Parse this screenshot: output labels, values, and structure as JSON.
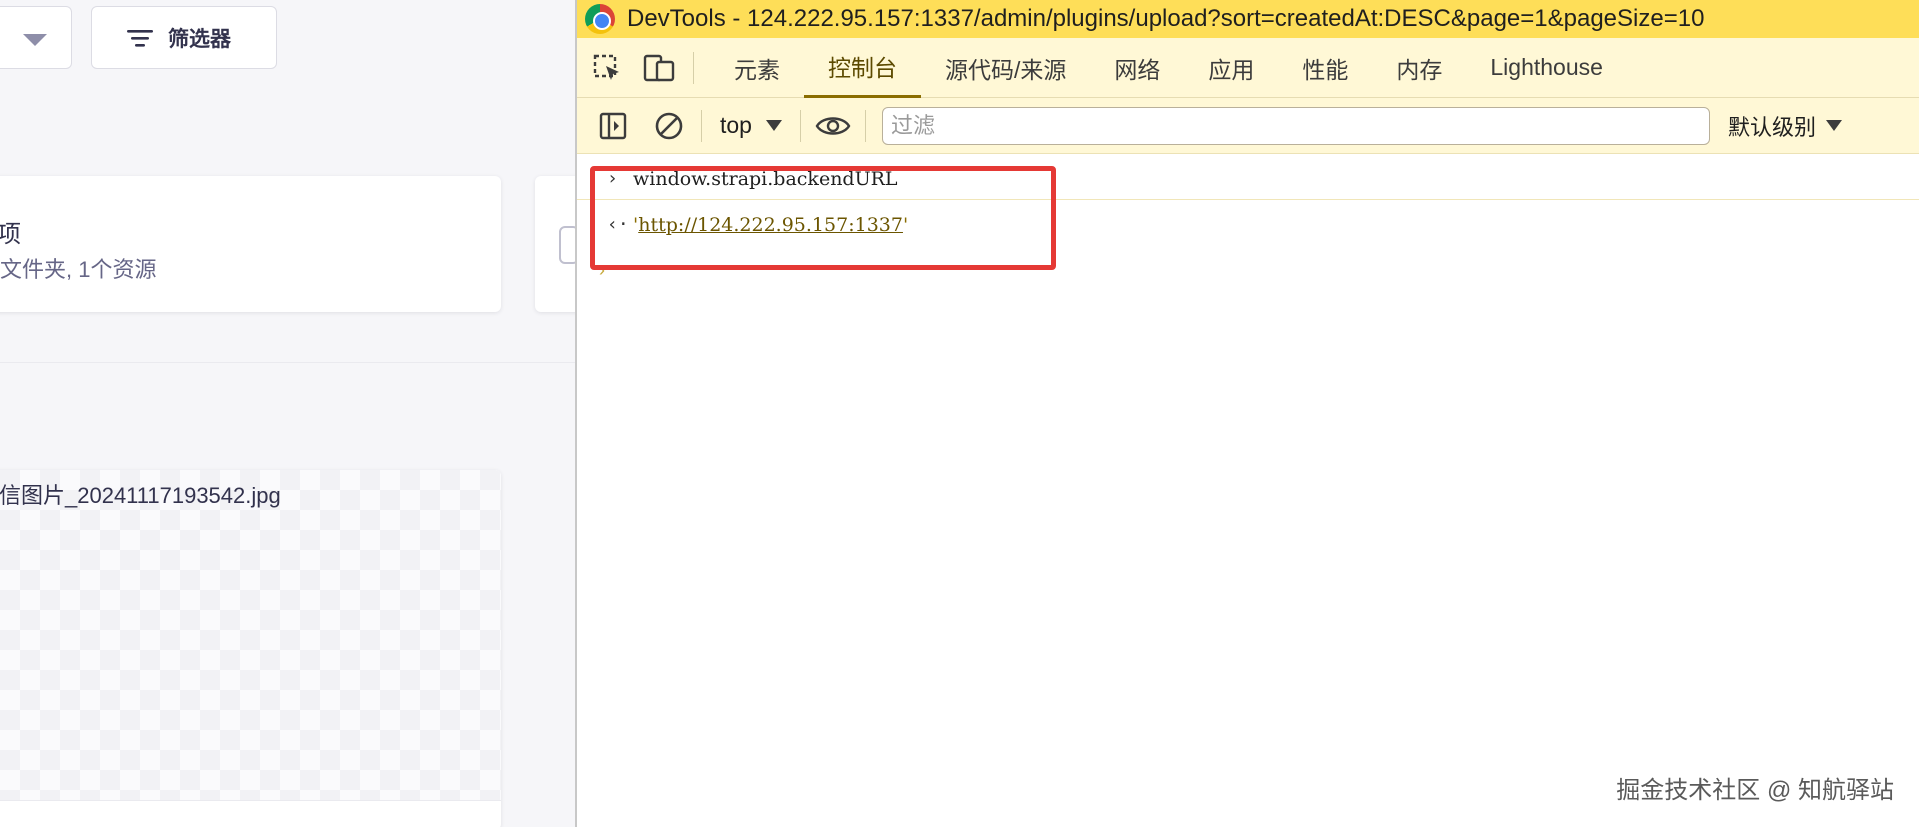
{
  "strapi": {
    "filter_button": "筛选器",
    "folder": {
      "title": "项",
      "subtitle": "文件夹, 1个资源"
    },
    "asset": {
      "name": "信图片_20241117193542.jpg"
    }
  },
  "devtools": {
    "title": "DevTools - 124.222.95.157:1337/admin/plugins/upload?sort=createdAt:DESC&page=1&pageSize=10",
    "tabs": [
      {
        "label": "元素"
      },
      {
        "label": "控制台"
      },
      {
        "label": "源代码/来源"
      },
      {
        "label": "网络"
      },
      {
        "label": "应用"
      },
      {
        "label": "性能"
      },
      {
        "label": "内存"
      },
      {
        "label": "Lighthouse"
      }
    ],
    "active_tab": "控制台",
    "console_toolbar": {
      "context": "top",
      "filter_placeholder": "过滤",
      "filter_value": "",
      "level": "默认级别"
    },
    "console": {
      "input_prompt": "›",
      "input": "window.strapi.backendURL",
      "output_prompt": "‹·",
      "output_quote_open": "'",
      "output_url": "http://124.222.95.157:1337",
      "output_quote_close": "'",
      "next_prompt": "›"
    }
  },
  "watermark": "掘金技术社区 @ 知航驿站",
  "colors": {
    "devtools_titlebar": "#fede58",
    "devtools_toolbar": "#fff8d6",
    "highlight": "#e53935",
    "strapi_bg": "#f6f6f9"
  }
}
